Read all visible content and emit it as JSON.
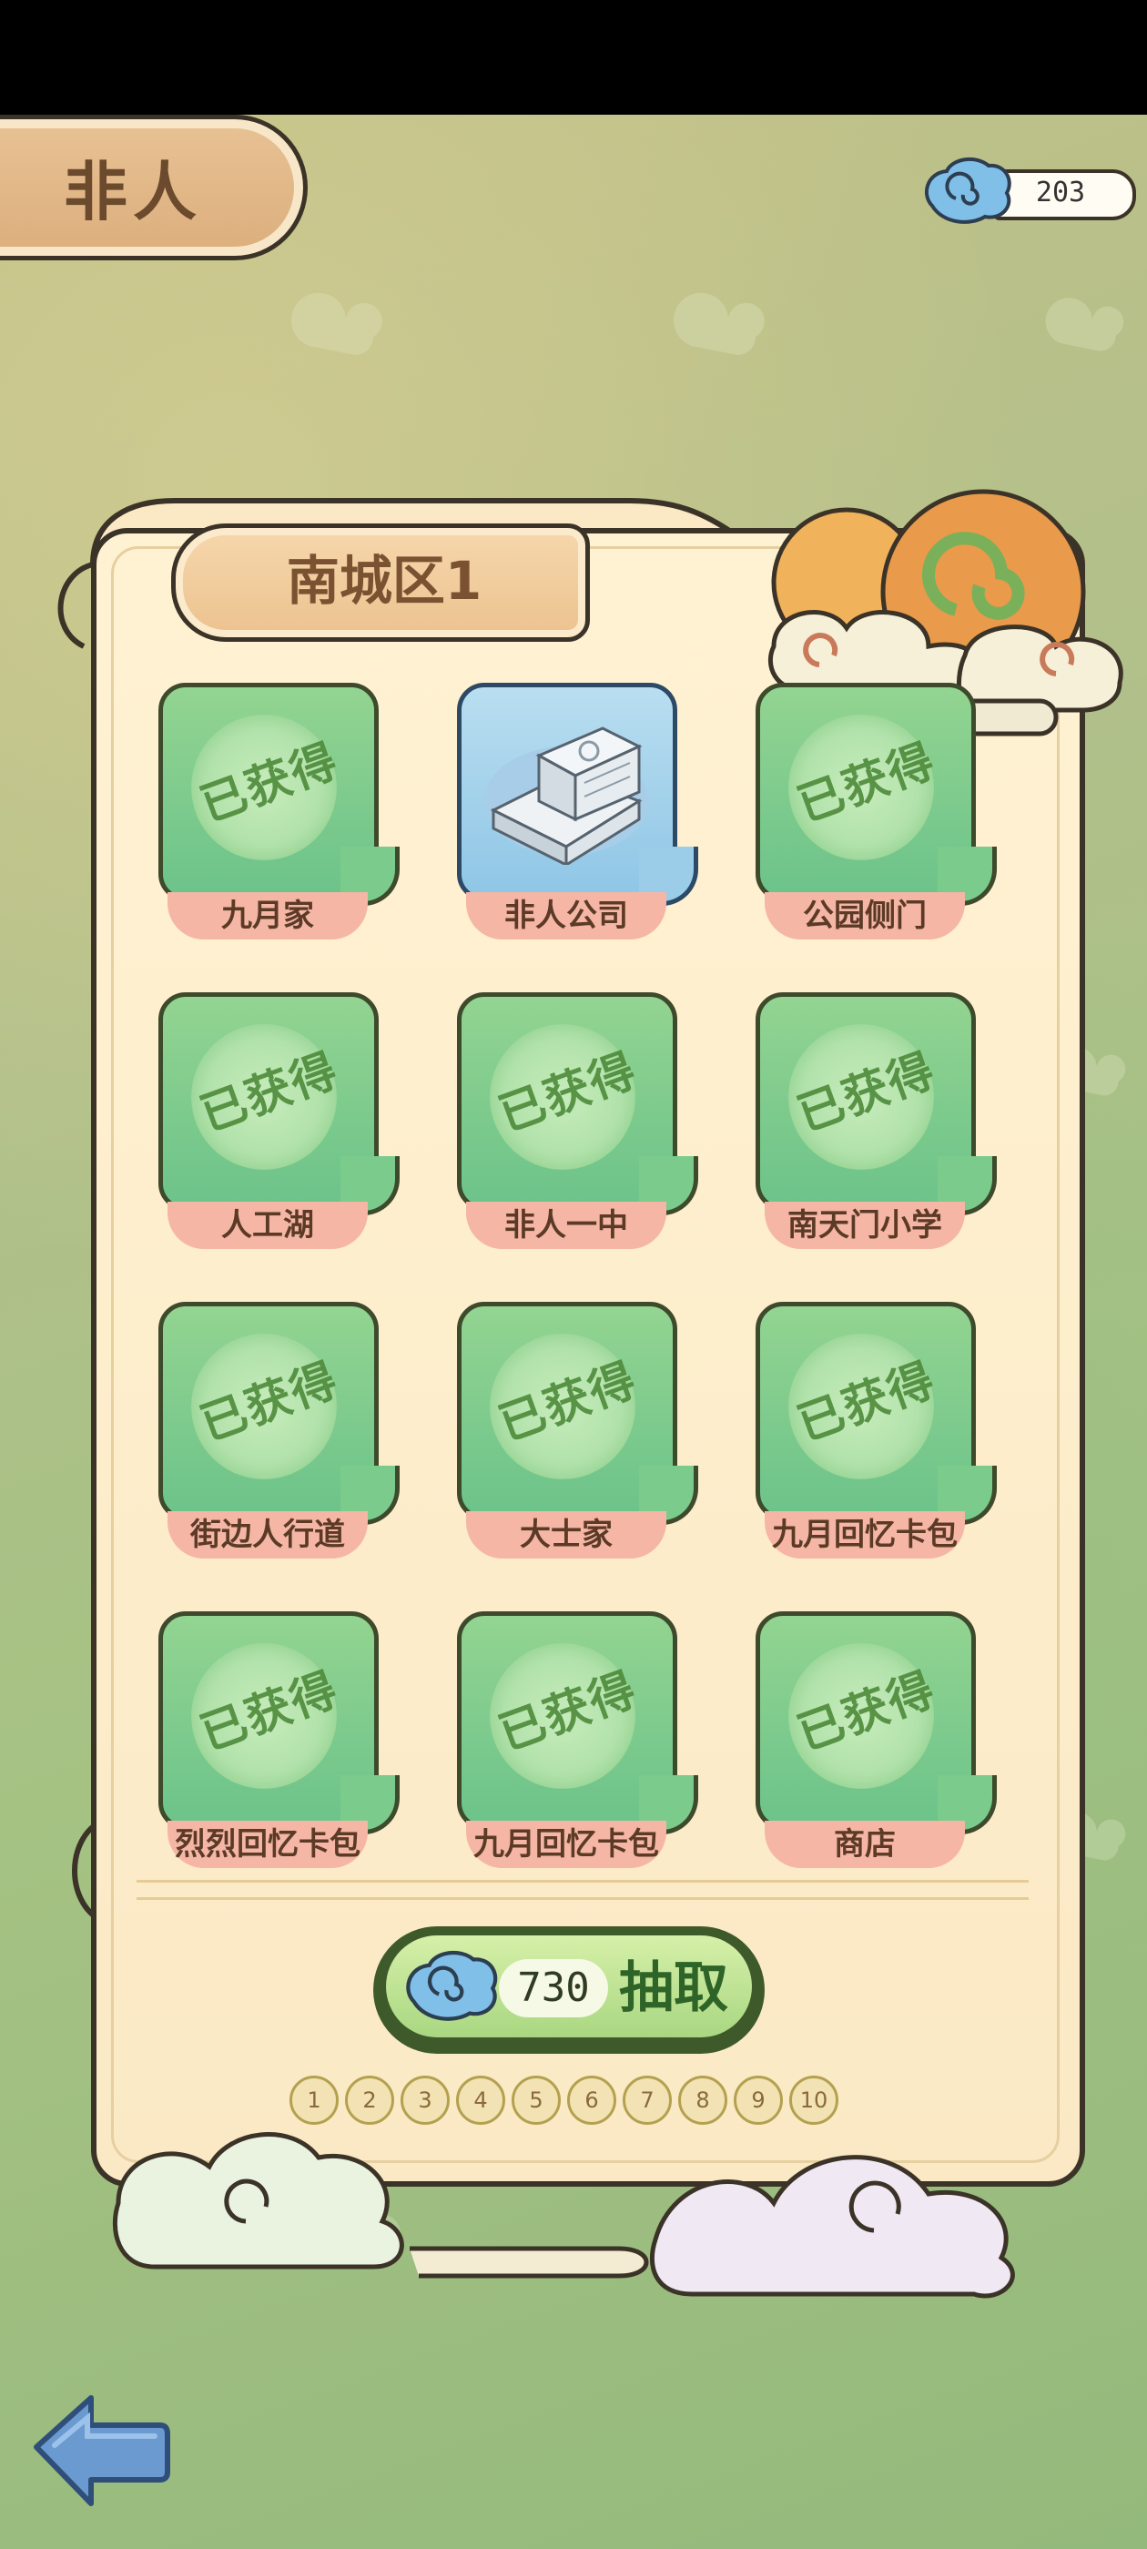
{
  "header": {
    "title": "非人",
    "currency_value": "203"
  },
  "region": {
    "name": "南城区1"
  },
  "stamp_text": "已获得",
  "cards": [
    {
      "label": "九月家",
      "obtained": true
    },
    {
      "label": "非人公司",
      "obtained": false
    },
    {
      "label": "公园侧门",
      "obtained": true
    },
    {
      "label": "人工湖",
      "obtained": true
    },
    {
      "label": "非人一中",
      "obtained": true
    },
    {
      "label": "南天门小学",
      "obtained": true
    },
    {
      "label": "街边人行道",
      "obtained": true
    },
    {
      "label": "大士家",
      "obtained": true
    },
    {
      "label": "九月回忆卡包",
      "obtained": true
    },
    {
      "label": "烈烈回忆卡包",
      "obtained": true
    },
    {
      "label": "九月回忆卡包",
      "obtained": true
    },
    {
      "label": "商店",
      "obtained": true
    }
  ],
  "draw_button": {
    "cost": "730",
    "label": "抽取"
  },
  "pager": {
    "pages": [
      "1",
      "2",
      "3",
      "4",
      "5",
      "6",
      "7",
      "8",
      "9",
      "10"
    ]
  },
  "colors": {
    "tile_green": "#7acb8c",
    "tile_blue": "#9ccde8",
    "label_pink": "#f5b6a6",
    "panel": "#fff2d3",
    "outline": "#3b3328"
  }
}
